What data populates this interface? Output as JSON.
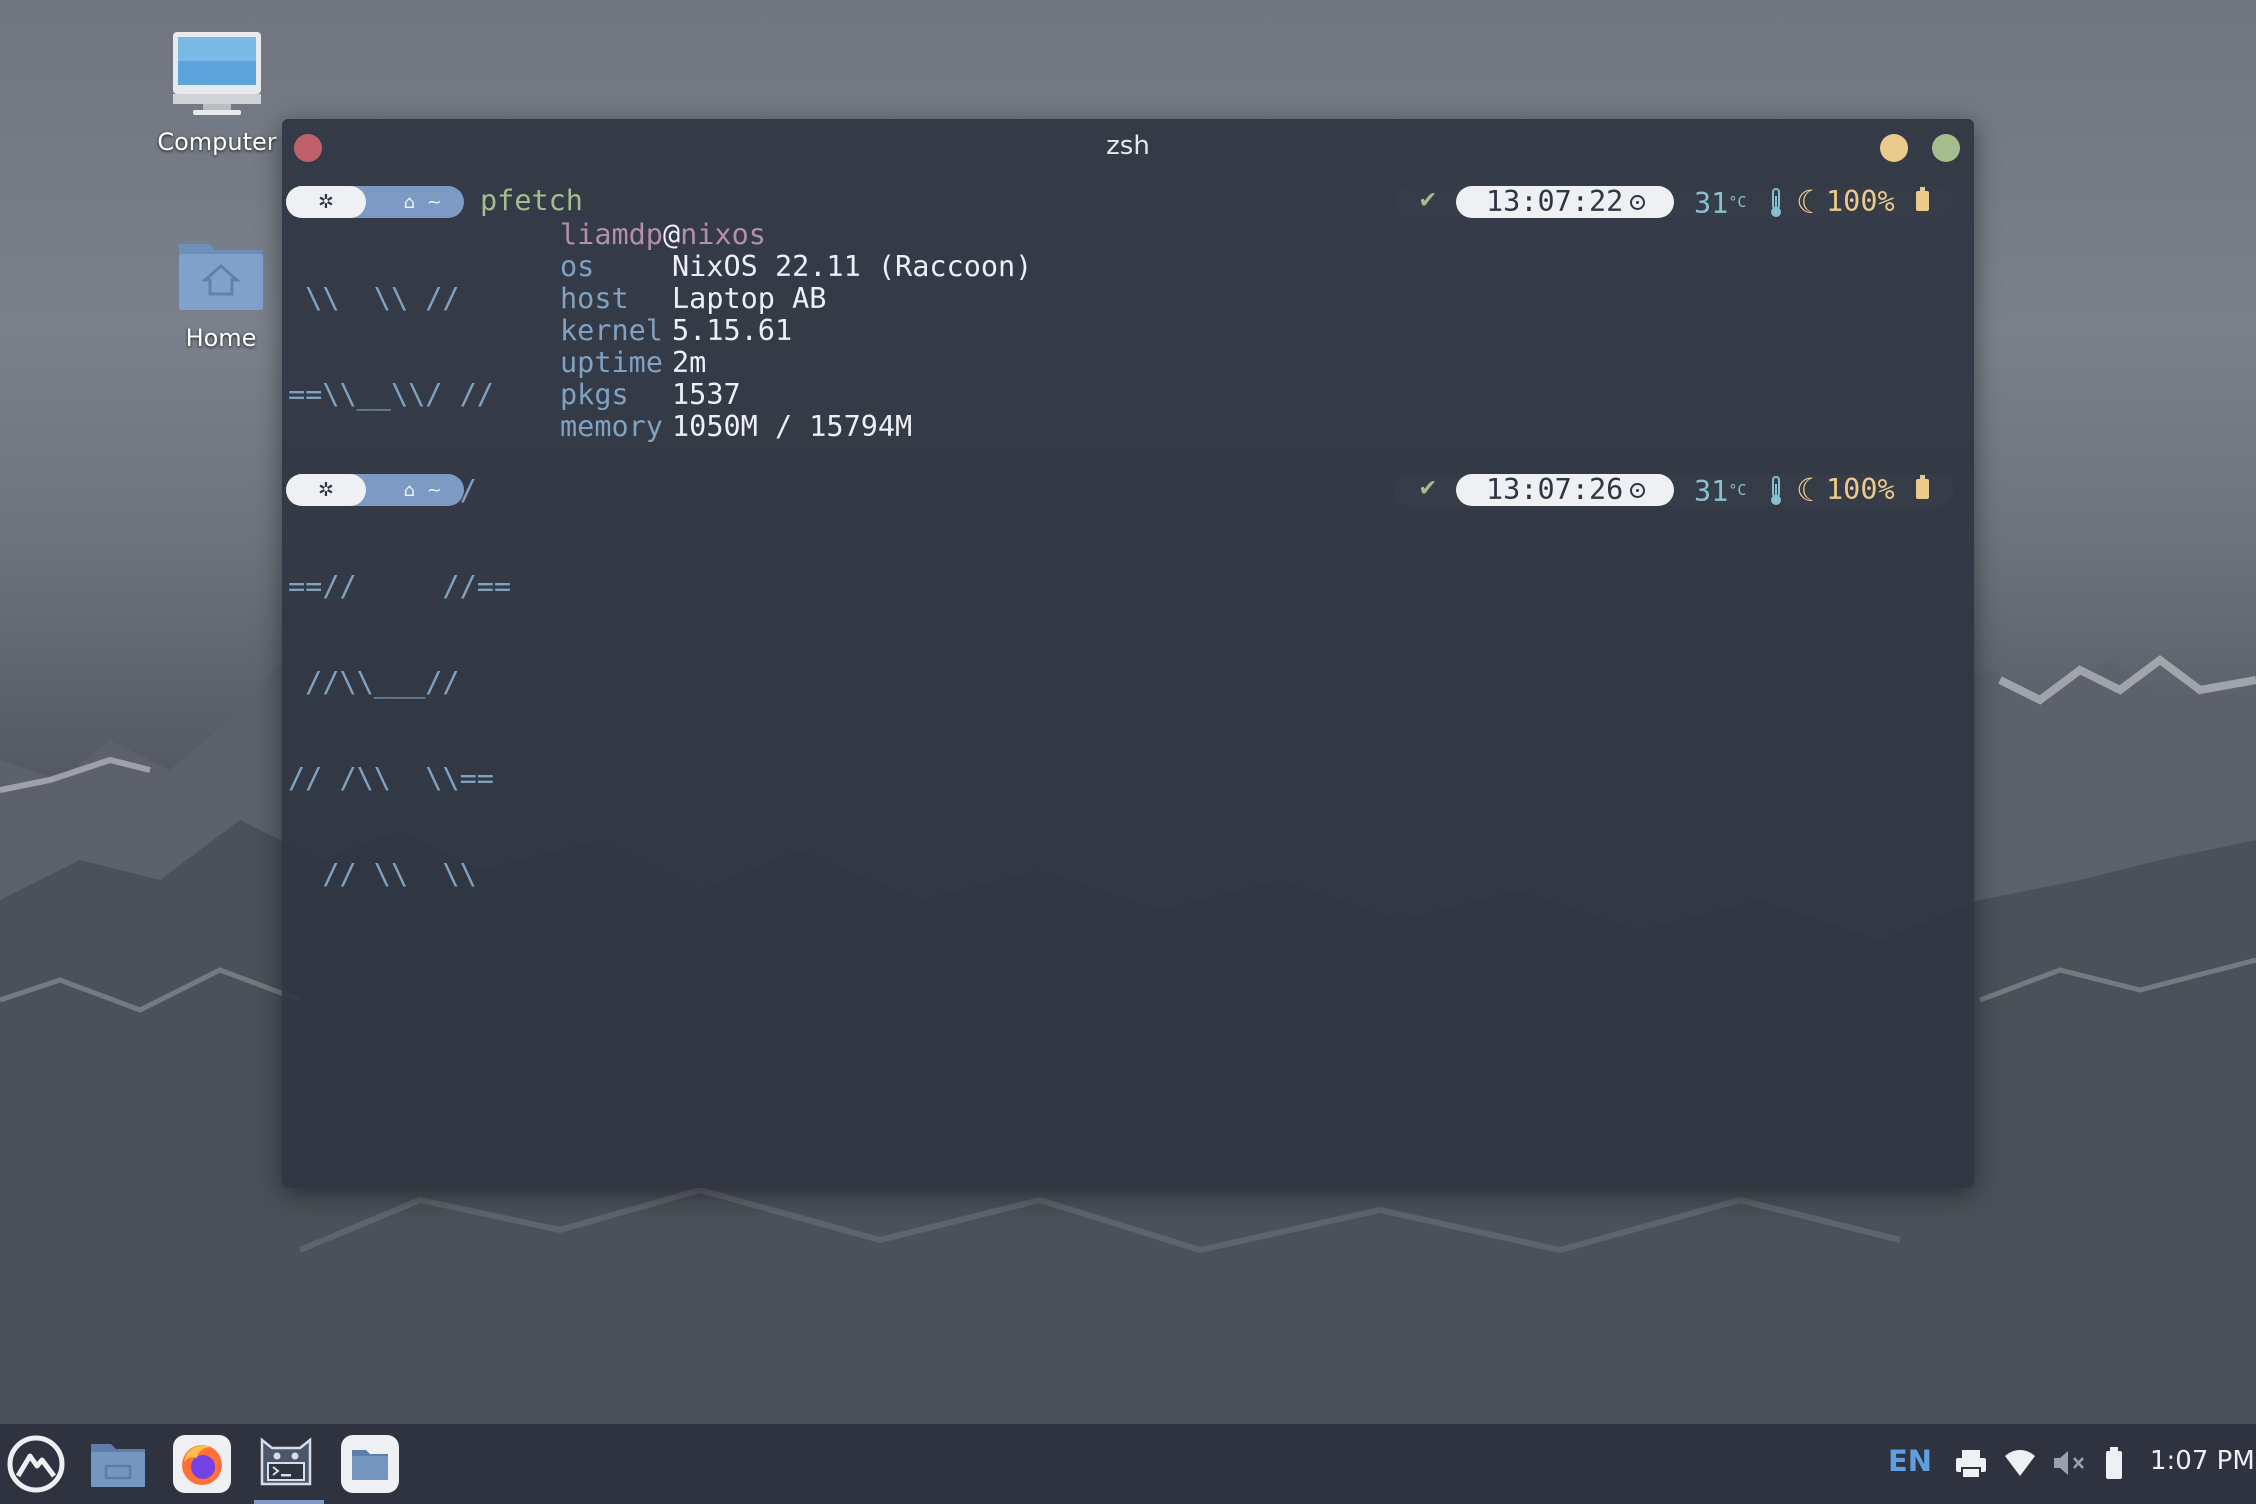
{
  "desktop": {
    "icons": [
      {
        "label": "Computer"
      },
      {
        "label": "Home"
      }
    ]
  },
  "window": {
    "title": "zsh",
    "close_color": "#bf616a",
    "minimize_color": "#ebcb8b",
    "maximize_color": "#a3be8c"
  },
  "prompt": {
    "dir_symbol": "~",
    "command": "pfetch"
  },
  "pfetch": {
    "user": "liamdp",
    "at": "@",
    "host": "nixos",
    "logo_lines": [
      " \\\\  \\\\ //",
      "==\\\\__\\\\/ //",
      "  //   \\\\//",
      "==//     //==",
      " //\\\\___//",
      "// /\\\\  \\\\==",
      "  // \\\\  \\\\"
    ],
    "fields": [
      {
        "key": "os",
        "value": "NixOS 22.11 (Raccoon)"
      },
      {
        "key": "host",
        "value": "Laptop AB"
      },
      {
        "key": "kernel",
        "value": "5.15.61"
      },
      {
        "key": "uptime",
        "value": "2m"
      },
      {
        "key": "pkgs",
        "value": "1537"
      },
      {
        "key": "memory",
        "value": "1050M / 15794M"
      }
    ]
  },
  "right_prompts": [
    {
      "check": "✔",
      "time": "13:07:22",
      "temp": "31",
      "temp_unit": "°C",
      "battery": "100%"
    },
    {
      "check": "✔",
      "time": "13:07:26",
      "temp": "31",
      "temp_unit": "°C",
      "battery": "100%"
    }
  ],
  "taskbar": {
    "language": "EN",
    "clock": "1:07 PM"
  }
}
